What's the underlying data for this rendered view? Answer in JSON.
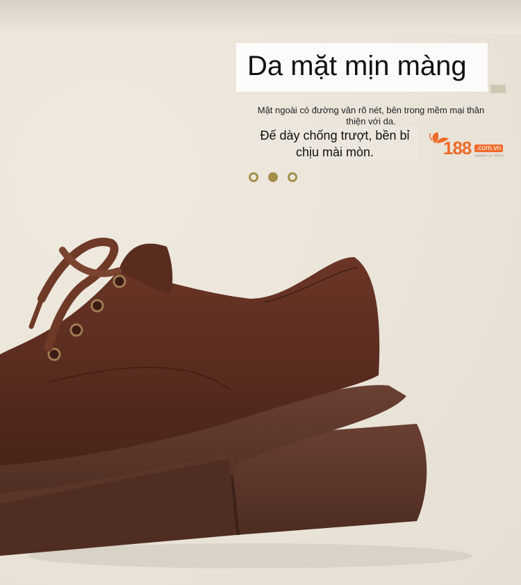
{
  "title": "Da mặt mịn màng",
  "description": "Mặt ngoài có đường vân rõ nét, bên trong mềm mại thân thiện với da.",
  "description_2": "Đế dày chống trượt, bền bỉ chịu mài mòn.",
  "logo": {
    "text": "188",
    "domain": ".com.vn",
    "tagline": "NHANH LÀ THÍCH"
  },
  "carousel": {
    "count": 3,
    "active_index": 1
  },
  "colors": {
    "accent": "#a38f4a",
    "logo": "#ef6b2a",
    "leather": "#5b2e21",
    "sole": "#5a3328"
  },
  "icons": [
    "leaf-logo-icon",
    "carousel-dot"
  ]
}
